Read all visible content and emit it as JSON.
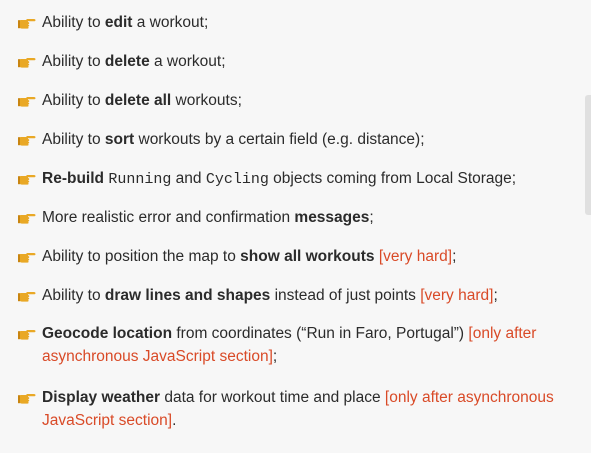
{
  "icon": "pointing-hand-icon",
  "colors": {
    "accent_hand": "#e9a825",
    "note_red": "#d94a27",
    "text": "#2b2b2b"
  },
  "items": [
    {
      "parts": [
        {
          "t": "Ability to ",
          "s": "n"
        },
        {
          "t": "edit",
          "s": "b"
        },
        {
          "t": " a workout;",
          "s": "n"
        }
      ]
    },
    {
      "parts": [
        {
          "t": "Ability to ",
          "s": "n"
        },
        {
          "t": "delete",
          "s": "b"
        },
        {
          "t": " a workout;",
          "s": "n"
        }
      ]
    },
    {
      "parts": [
        {
          "t": "Ability to ",
          "s": "n"
        },
        {
          "t": "delete all",
          "s": "b"
        },
        {
          "t": " workouts;",
          "s": "n"
        }
      ]
    },
    {
      "parts": [
        {
          "t": "Ability to ",
          "s": "n"
        },
        {
          "t": "sort",
          "s": "b"
        },
        {
          "t": " workouts by a certain field (e.g. distance);",
          "s": "n"
        }
      ]
    },
    {
      "parts": [
        {
          "t": "Re-build",
          "s": "b"
        },
        {
          "t": " ",
          "s": "n"
        },
        {
          "t": "Running",
          "s": "m"
        },
        {
          "t": " and ",
          "s": "n"
        },
        {
          "t": "Cycling",
          "s": "m"
        },
        {
          "t": " objects coming from Local Storage;",
          "s": "n"
        }
      ]
    },
    {
      "parts": [
        {
          "t": "More realistic error and confirmation ",
          "s": "n"
        },
        {
          "t": "messages",
          "s": "b"
        },
        {
          "t": ";",
          "s": "n"
        }
      ]
    },
    {
      "parts": [
        {
          "t": "Ability to position the map to ",
          "s": "n"
        },
        {
          "t": "show all workouts",
          "s": "b"
        },
        {
          "t": " ",
          "s": "n"
        },
        {
          "t": "[very hard]",
          "s": "r"
        },
        {
          "t": ";",
          "s": "n"
        }
      ]
    },
    {
      "parts": [
        {
          "t": "Ability to ",
          "s": "n"
        },
        {
          "t": "draw lines and shapes",
          "s": "b"
        },
        {
          "t": " instead of just points ",
          "s": "n"
        },
        {
          "t": "[very hard]",
          "s": "r"
        },
        {
          "t": ";",
          "s": "n"
        }
      ]
    },
    {
      "parts": [
        {
          "t": "Geocode location",
          "s": "b"
        },
        {
          "t": " from coordinates (“Run in Faro, Portugal”) ",
          "s": "n"
        },
        {
          "t": "[only after asynchronous JavaScript section]",
          "s": "r"
        },
        {
          "t": ";",
          "s": "n"
        }
      ]
    },
    {
      "parts": [
        {
          "t": "Display weather",
          "s": "b"
        },
        {
          "t": " data for workout time and place  ",
          "s": "n"
        },
        {
          "t": "[only after asynchronous JavaScript section]",
          "s": "r"
        },
        {
          "t": ".",
          "s": "n"
        }
      ]
    }
  ]
}
